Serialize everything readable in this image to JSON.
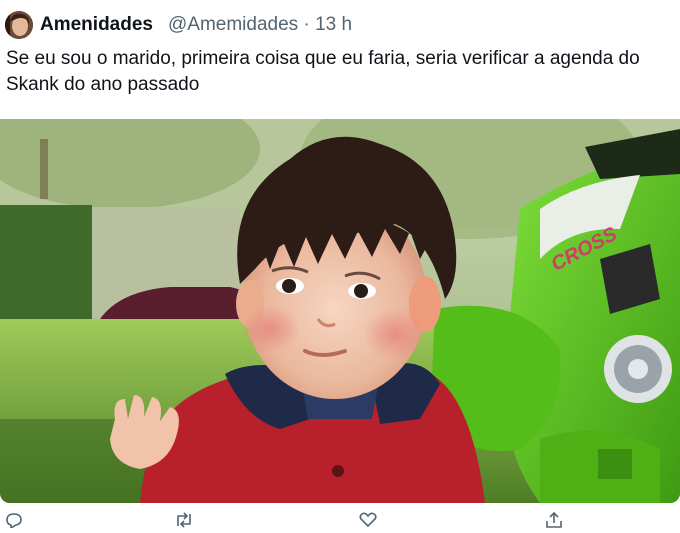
{
  "tweet": {
    "author_name": "Amenidades",
    "author_handle": "@Amemidades",
    "separator": "·",
    "time": "13 h",
    "text": "Se eu sou o marido, primeira coisa que eu faria, seria verificar a agenda do Skank do ano passado"
  },
  "media": {
    "toy_sticker_text": "CROSS"
  },
  "icons": [
    "reply-icon",
    "retweet-icon",
    "like-icon",
    "share-icon"
  ],
  "colors": {
    "text": "#0f1419",
    "secondary": "#536471",
    "toy_green": "#5ec81e"
  }
}
